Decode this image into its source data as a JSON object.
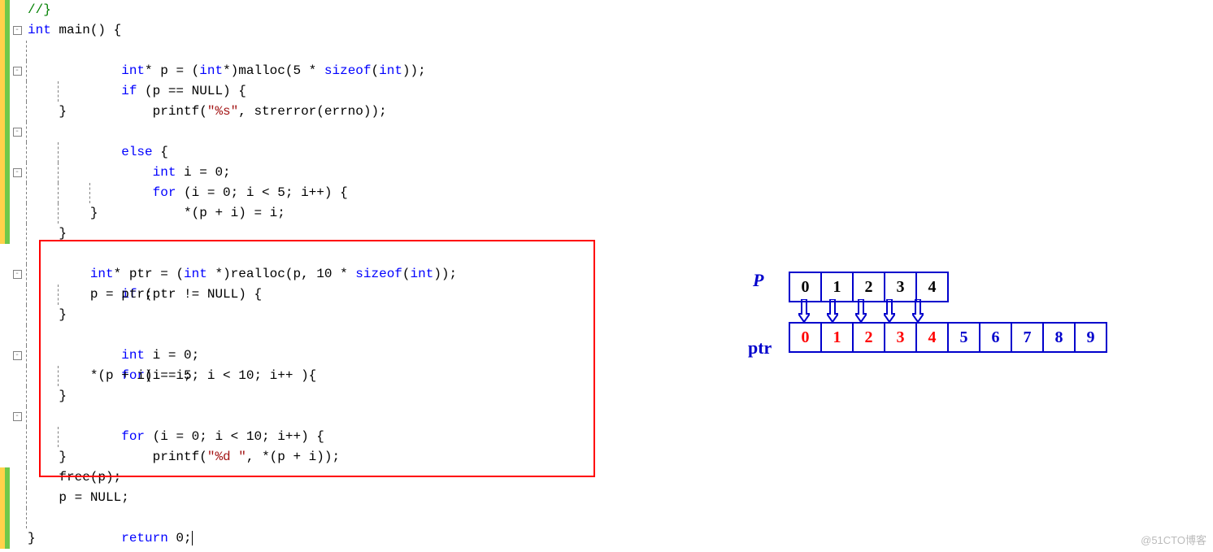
{
  "code": {
    "l0": "//}",
    "l1_pre": "int",
    "l1_post": " main() {",
    "l2a": "    int",
    "l2b": "* p = (",
    "l2c": "int",
    "l2d": "*)malloc(5 * ",
    "l2e": "sizeof",
    "l2f": "(",
    "l2g": "int",
    "l2h": "));",
    "l3a": "    if",
    "l3b": " (p == NULL) {",
    "l4a": "        printf(",
    "l4s": "\"%s\"",
    "l4b": ", strerror(errno));",
    "l5": "    }",
    "l6a": "    else",
    "l6b": " {",
    "l7a": "        int",
    "l7b": " i = 0;",
    "l8a": "        for",
    "l8b": " (i = 0; i < 5; i++) {",
    "l9": "            *(p + i) = i;",
    "l10": "        }",
    "l11": "    }",
    "l12a": "int",
    "l12b": "* ptr = (",
    "l12c": "int",
    "l12d": " *)realloc(p, 10 * ",
    "l12e": "sizeof",
    "l12f": "(",
    "l12g": "int",
    "l12h": "));",
    "l13a": "    if",
    "l13b": " (ptr != NULL) {",
    "l14": "        p = ptr;",
    "l15": "    }",
    "l16a": "    int",
    "l16b": " i = 0;",
    "l17a": "    for",
    "l17b": "(i = 5; i < 10; i++ ){",
    "l18": "        *(p + i) = i;",
    "l19": "    }",
    "l20a": "    for",
    "l20b": " (i = 0; i < 10; i++) {",
    "l21a": "        printf(",
    "l21s": "\"%d \"",
    "l21b": ", *(p + i));",
    "l22": "    }",
    "l23": "    free(p);",
    "l24": "    p = NULL;",
    "l25a": "    return",
    "l25b": " 0;",
    "l26": "}"
  },
  "diagram": {
    "label_p": "P",
    "label_ptr": "ptr",
    "row1": [
      "0",
      "1",
      "2",
      "3",
      "4"
    ],
    "row2": [
      "0",
      "1",
      "2",
      "3",
      "4",
      "5",
      "6",
      "7",
      "8",
      "9"
    ]
  },
  "watermark": "@51CTO博客"
}
